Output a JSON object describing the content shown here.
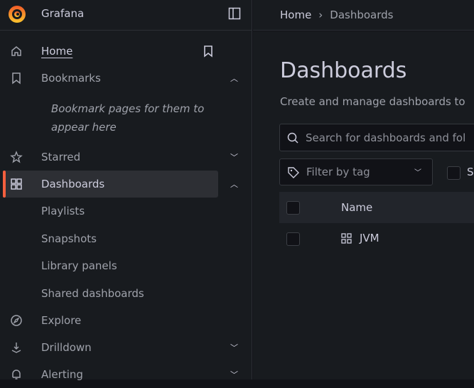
{
  "app": {
    "title": "Grafana"
  },
  "breadcrumb": {
    "home": "Home",
    "separator": "›",
    "current": "Dashboards"
  },
  "sidebar": {
    "items": [
      {
        "label": "Home",
        "icon": "home-icon"
      },
      {
        "label": "Bookmarks",
        "icon": "bookmark-icon",
        "expanded": true
      },
      {
        "label": "Starred",
        "icon": "star-icon",
        "expanded": false
      },
      {
        "label": "Dashboards",
        "icon": "apps-icon",
        "expanded": true,
        "active": true
      },
      {
        "label": "Explore",
        "icon": "compass-icon"
      },
      {
        "label": "Drilldown",
        "icon": "drilldown-icon",
        "expanded": false
      },
      {
        "label": "Alerting",
        "icon": "bell-icon",
        "expanded": false
      }
    ],
    "bookmarks_hint": "Bookmark pages for them to appear here",
    "dashboards_children": [
      "Playlists",
      "Snapshots",
      "Library panels",
      "Shared dashboards"
    ]
  },
  "main": {
    "title": "Dashboards",
    "description": "Create and manage dashboards to",
    "search_placeholder": "Search for dashboards and fol",
    "filter_tag": "Filter by tag",
    "checkbox_label": "S",
    "table": {
      "header": "Name",
      "rows": [
        {
          "name": "JVM",
          "icon": "apps-icon"
        }
      ]
    }
  },
  "colors": {
    "accent": "#f55f3e",
    "sidebar_bg": "#181b1f",
    "canvas": "#111217"
  }
}
